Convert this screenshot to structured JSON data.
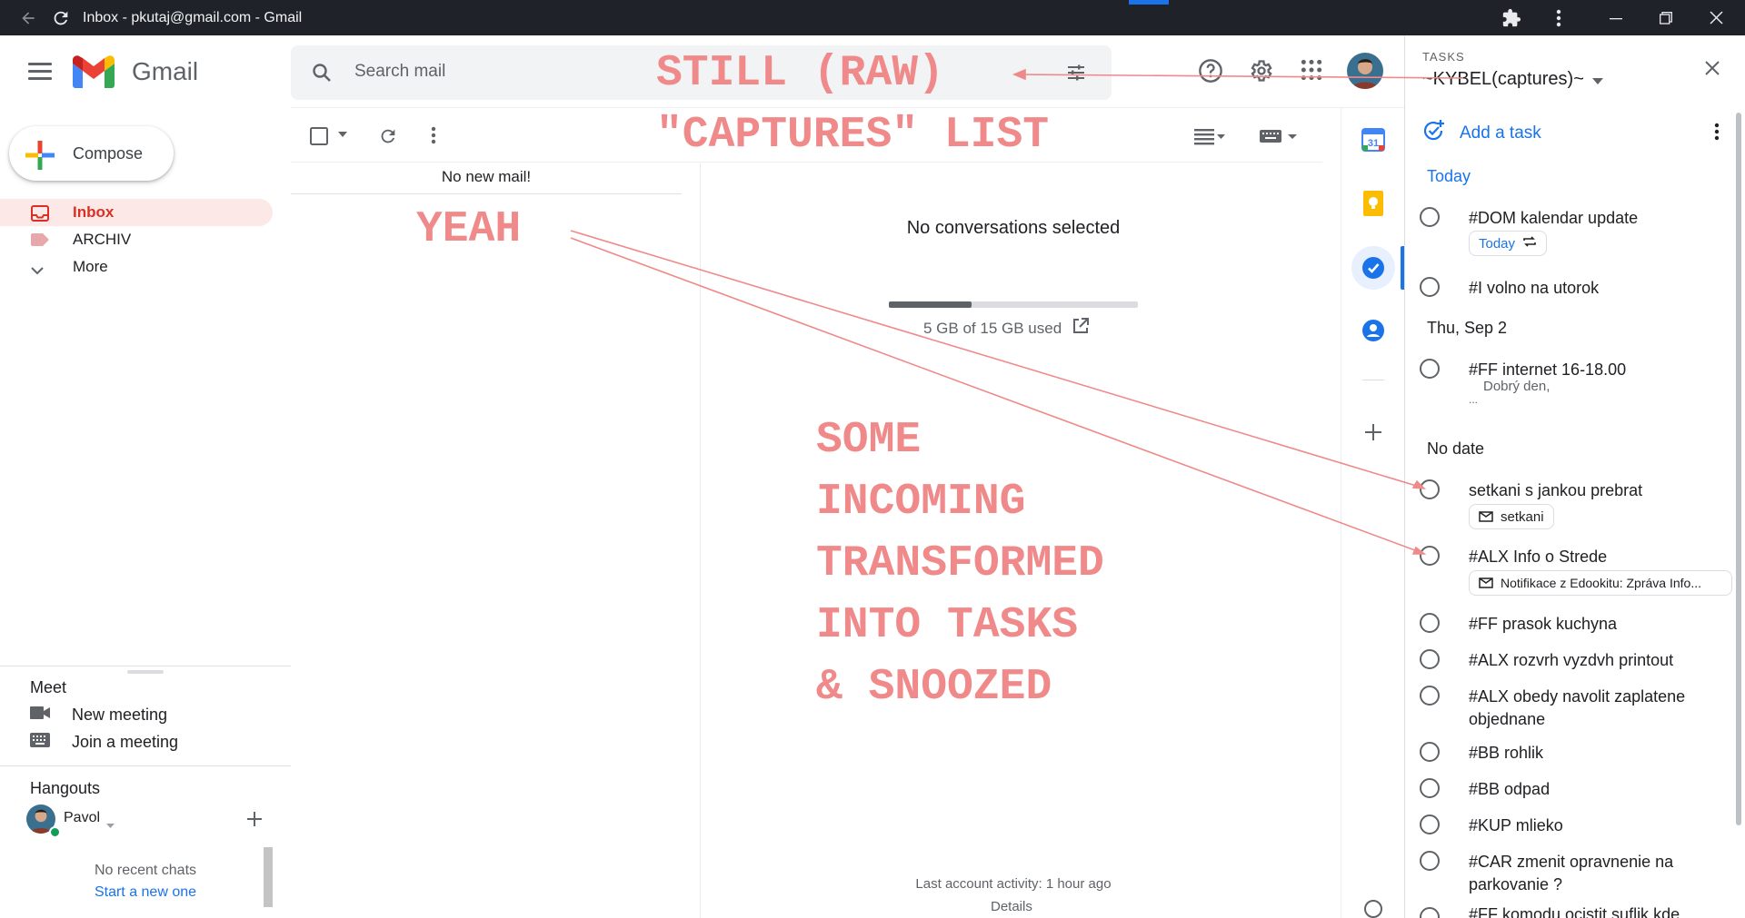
{
  "window": {
    "title": "Inbox - pkutaj@gmail.com - Gmail"
  },
  "header": {
    "app_name": "Gmail",
    "search_placeholder": "Search mail"
  },
  "sidebar": {
    "compose_label": "Compose",
    "nav": [
      {
        "label": "Inbox",
        "active": true
      },
      {
        "label": "ARCHIV",
        "active": false
      },
      {
        "label": "More",
        "active": false
      }
    ],
    "meet": {
      "title": "Meet",
      "new_meeting": "New meeting",
      "join_meeting": "Join a meeting"
    },
    "hangouts": {
      "title": "Hangouts",
      "user": "Pavol",
      "no_recent": "No recent chats",
      "start_new": "Start a new one"
    }
  },
  "mail_list": {
    "empty_text": "No new mail!"
  },
  "reading_pane": {
    "no_selection": "No conversations selected",
    "storage_text": "5 GB of 15 GB used",
    "storage_used_fraction": 0.333,
    "last_activity": "Last account activity: 1 hour ago",
    "details": "Details"
  },
  "tasks_panel": {
    "kicker": "TASKS",
    "list_name": "~KYBEL(captures)~",
    "add_task": "Add a task",
    "sections": {
      "today": "Today",
      "thu": "Thu, Sep 2",
      "no_date": "No date"
    },
    "tasks": [
      {
        "title": "#DOM kalendar update",
        "chip": "Today"
      },
      {
        "title": "#I volno na utorok"
      },
      {
        "title": "#FF internet 16-18.00",
        "note": "Dobrý den,",
        "note2": "..."
      },
      {
        "title": "setkani s jankou prebrat",
        "chip": "setkani"
      },
      {
        "title": "#ALX Info o Strede",
        "chip": "Notifikace z Edookitu: Zpráva Info..."
      },
      {
        "title": "#FF prasok kuchyna"
      },
      {
        "title": "#ALX rozvrh vyzdvh printout"
      },
      {
        "title": "#ALX obedy navolit zaplatene objednane"
      },
      {
        "title": "#BB rohlik"
      },
      {
        "title": "#BB odpad"
      },
      {
        "title": "#KUP mlieko"
      },
      {
        "title": "#CAR zmenit opravnenie na parkovanie ?"
      },
      {
        "title": "#FF komodu ocistit suflik kde"
      }
    ]
  },
  "annotations": {
    "still_raw": "STILL (RAW)",
    "captures_list": "\"CAPTURES\" LIST",
    "yeah": "YEAH",
    "some": "SOME",
    "incoming": "INCOMING",
    "transformed": "TRANSFORMED",
    "into_tasks": "INTO TASKS",
    "snoozed": "& SNOOZED"
  },
  "colors": {
    "accent": "#1a73e8",
    "inbox_red": "#d93025",
    "annotation": "#f08a8a",
    "titlebar": "#1f2329"
  }
}
